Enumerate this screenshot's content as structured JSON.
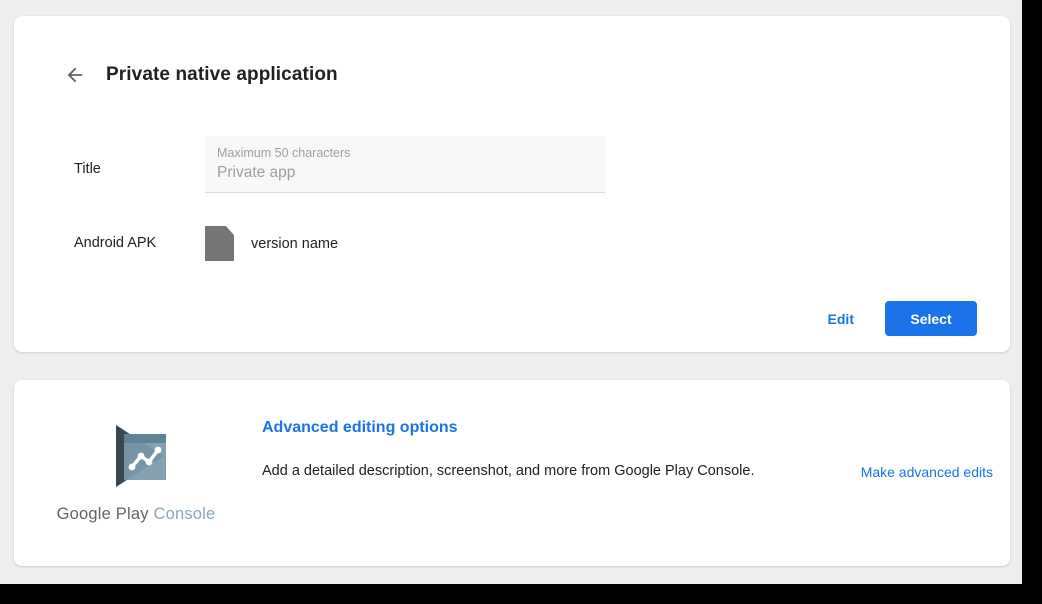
{
  "colors": {
    "accent_blue": "#1a73e8",
    "page_background": "#eeeeee",
    "card_background": "#ffffff",
    "text_primary": "#202124",
    "text_muted": "#9aa0a6",
    "file_icon_gray": "#757575",
    "logo_play_dark": "#3d4f5c",
    "logo_card_light": "#7b9aad",
    "wordmark_dark": "#5f6368",
    "wordmark_light": "#8aa7bb"
  },
  "app_card": {
    "back_icon": "arrow-left-icon",
    "title": "Private native application",
    "fields": [
      {
        "label": "Title",
        "hint": "Maximum 50 characters",
        "value": "Private app"
      },
      {
        "label": "Android APK",
        "file_icon": "file-document-icon",
        "value": "version name"
      }
    ],
    "actions": {
      "edit_label": "Edit",
      "select_label": "Select"
    }
  },
  "advanced_card": {
    "logo": {
      "icon": "google-play-console-logo",
      "wordmark_primary": "Google Play",
      "wordmark_secondary": "Console"
    },
    "heading": "Advanced editing options",
    "description": "Add a detailed description, screenshot, and more from Google Play Console.",
    "link_label": "Make advanced edits"
  }
}
